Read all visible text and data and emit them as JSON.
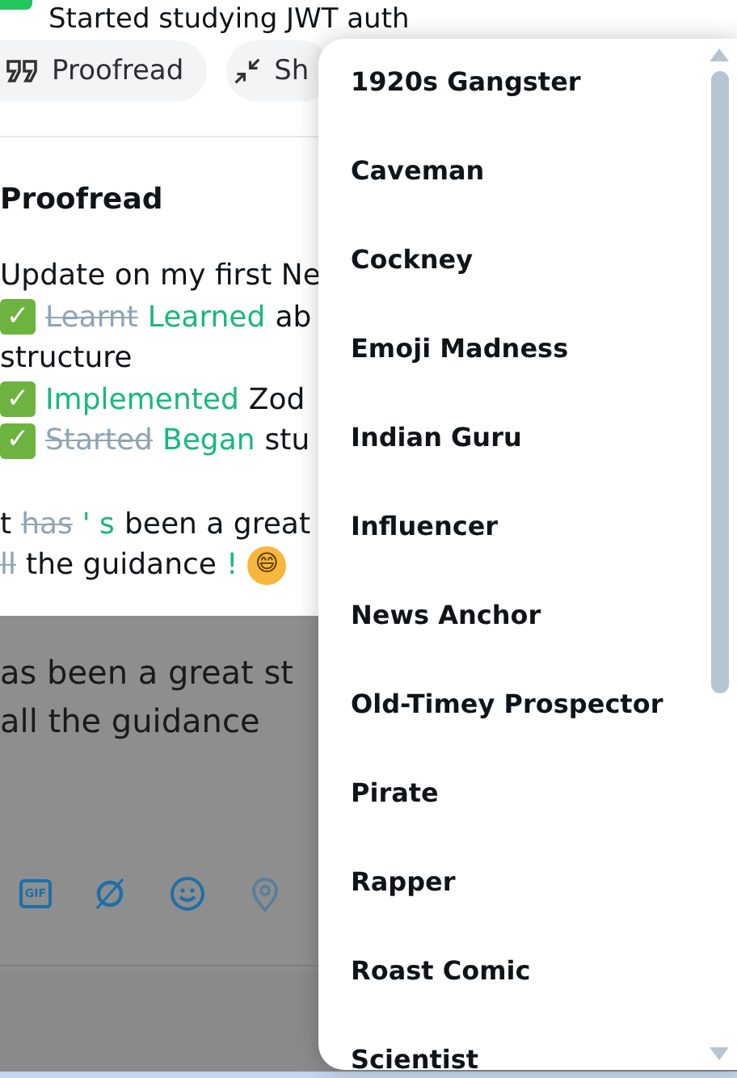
{
  "header": {
    "title": "Started studying JWT auth"
  },
  "chips": [
    {
      "kind": "quote",
      "label": "Proofread"
    },
    {
      "kind": "shrink",
      "label": "Sh"
    }
  ],
  "proofread": {
    "title": "Proofread",
    "paragraphs": [
      [
        [
          {
            "kind": "plain",
            "text": "Update on my first Ne"
          }
        ],
        [
          {
            "kind": "check",
            "text": "✓"
          },
          {
            "kind": "deleted",
            "text": "Learnt"
          },
          {
            "kind": "inserted",
            "text": "Learned"
          },
          {
            "kind": "plain",
            "text": "ab"
          }
        ],
        [
          {
            "kind": "plain",
            "text": "structure"
          }
        ],
        [
          {
            "kind": "check",
            "text": "✓"
          },
          {
            "kind": "inserted",
            "text": "Implemented"
          },
          {
            "kind": "plain",
            "text": "Zod"
          }
        ],
        [
          {
            "kind": "check",
            "text": "✓"
          },
          {
            "kind": "deleted",
            "text": "Started"
          },
          {
            "kind": "inserted",
            "text": "Began"
          },
          {
            "kind": "plain",
            "text": "stu"
          }
        ]
      ],
      [
        [
          {
            "kind": "plain",
            "text": "t"
          },
          {
            "kind": "deleted",
            "text": "has"
          },
          {
            "kind": "inserted",
            "text": "' s"
          },
          {
            "kind": "plain",
            "text": "been a great"
          }
        ],
        [
          {
            "kind": "deleted",
            "text": "ll"
          },
          {
            "kind": "plain",
            "text": "the guidance"
          },
          {
            "kind": "inserted",
            "text": "!"
          },
          {
            "kind": "emoji",
            "text": "😄"
          }
        ]
      ]
    ]
  },
  "composer": {
    "lines": [
      "as been a great st",
      "all the guidance"
    ],
    "tools": [
      {
        "kind": "gif",
        "label": "GIF",
        "disabled": false
      },
      {
        "kind": "slashed",
        "disabled": false
      },
      {
        "kind": "smile",
        "disabled": false
      },
      {
        "kind": "location",
        "disabled": true
      }
    ]
  },
  "menu": {
    "items": [
      "1920s Gangster",
      "Caveman",
      "Cockney",
      "Emoji Madness",
      "Indian Guru",
      "Influencer",
      "News Anchor",
      "Old-Timey Prospector",
      "Pirate",
      "Rapper",
      "Roast Comic",
      "Scientist"
    ]
  }
}
